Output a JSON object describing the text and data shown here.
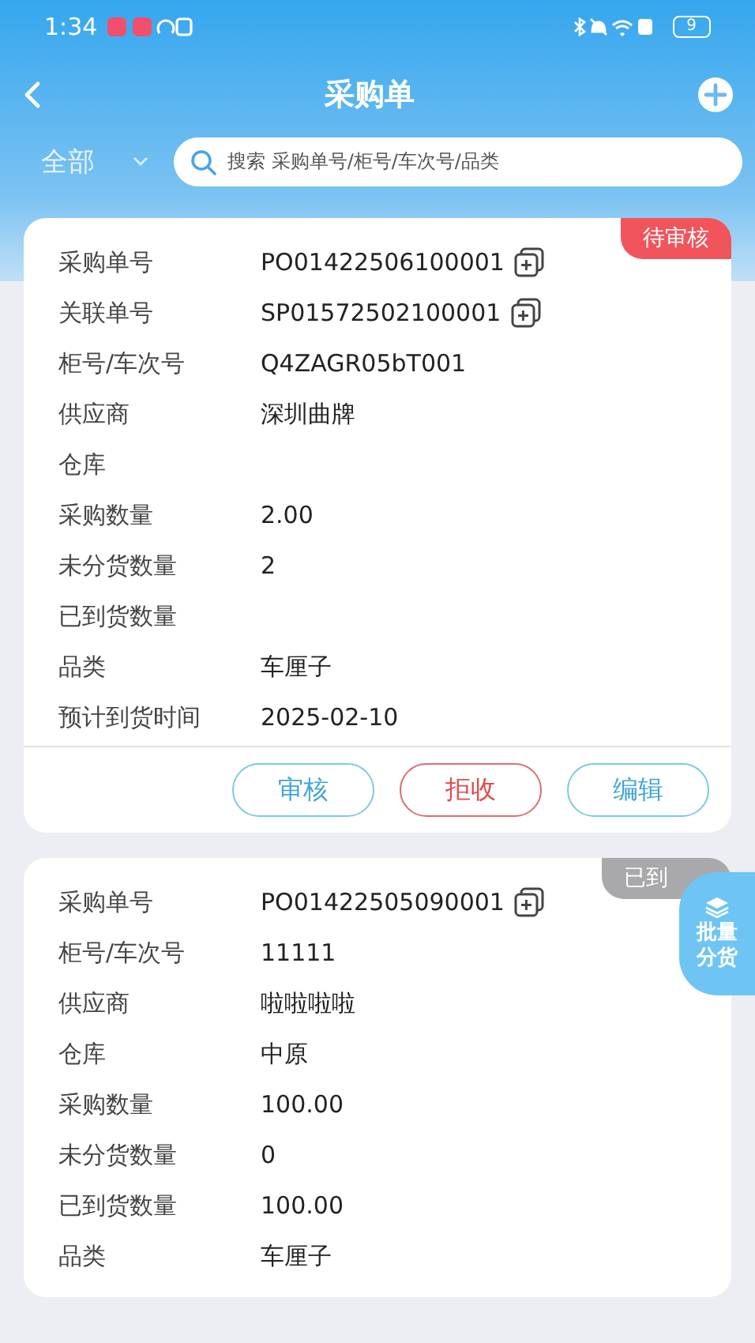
{
  "status_bar": {
    "time": "1:34",
    "battery": "9"
  },
  "header": {
    "title": "采购单"
  },
  "filter": {
    "label": "全部"
  },
  "search": {
    "placeholder": "搜索 采购单号/柜号/车次号/品类"
  },
  "orders": [
    {
      "status": "待审核",
      "color": "#f1545b",
      "rows": [
        {
          "label": "采购单号",
          "value": "PO01422506100001",
          "copyable": true
        },
        {
          "label": "关联单号",
          "value": "SP01572502100001",
          "copyable": true
        },
        {
          "label": "柜号/车次号",
          "value": "Q4ZAGR05bT001",
          "copyable": false
        },
        {
          "label": "供应商",
          "value": "深圳曲牌",
          "copyable": false
        },
        {
          "label": "仓库",
          "copyable": false
        },
        {
          "label": "采购数量",
          "value": "2.00",
          "copyable": false
        },
        {
          "label": "未分货数量",
          "value": "2",
          "copyable": false
        },
        {
          "label": "已到货数量",
          "copyable": false
        },
        {
          "label": "品类",
          "value": "车厘子",
          "copyable": false
        },
        {
          "label": "预计到货时间",
          "value": "2025-02-10",
          "copyable": false
        }
      ],
      "actions": [
        {
          "label": "审核",
          "kind": "primary"
        },
        {
          "label": "拒收",
          "kind": "danger"
        },
        {
          "label": "编辑",
          "kind": "primary"
        }
      ]
    },
    {
      "status": "已到",
      "color": "#a9a9ab",
      "rows": [
        {
          "label": "采购单号",
          "value": "PO01422505090001",
          "copyable": true
        },
        {
          "label": "柜号/车次号",
          "value": "11111",
          "copyable": false
        },
        {
          "label": "供应商",
          "value": "啦啦啦啦",
          "copyable": false
        },
        {
          "label": "仓库",
          "value": "中原",
          "copyable": false
        },
        {
          "label": "采购数量",
          "value": "100.00",
          "copyable": false
        },
        {
          "label": "未分货数量",
          "value": "0",
          "copyable": false
        },
        {
          "label": "已到货数量",
          "value": "100.00",
          "copyable": false
        },
        {
          "label": "品类",
          "value": "车厘子",
          "copyable": false
        }
      ]
    }
  ],
  "float_button": {
    "label": "批量分货"
  }
}
